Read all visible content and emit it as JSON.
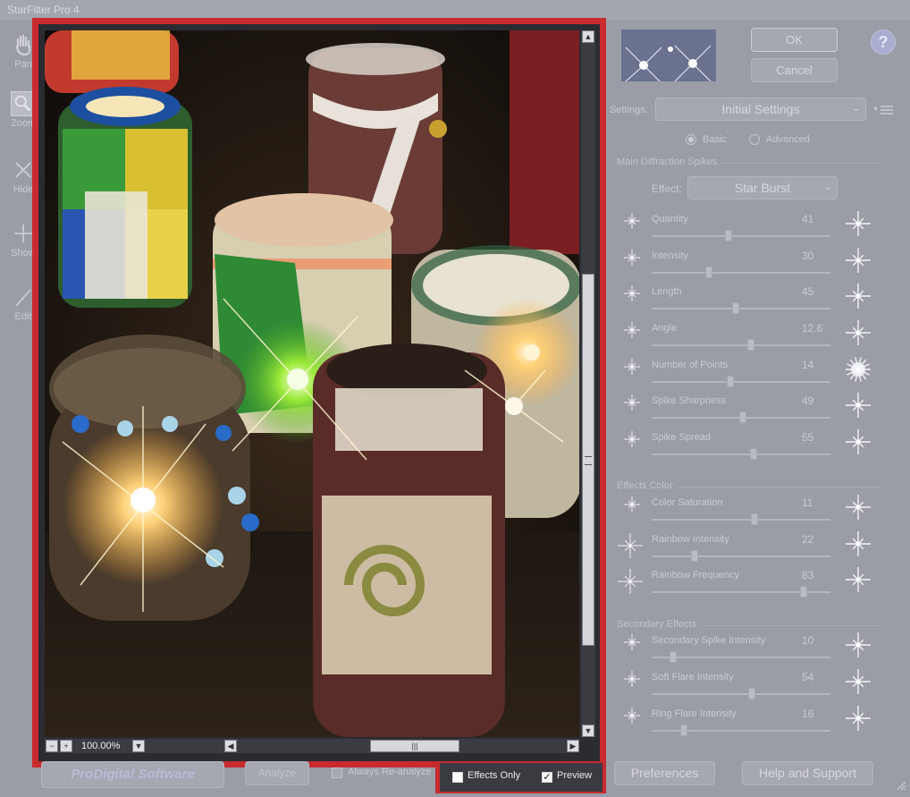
{
  "window": {
    "title": "StarFilter Pro 4"
  },
  "toolbar": {
    "items": [
      {
        "label": "Pan",
        "icon": "hand-icon"
      },
      {
        "label": "Zoom",
        "icon": "magnifier-icon"
      },
      {
        "label": "Hide",
        "icon": "x-icon"
      },
      {
        "label": "Show",
        "icon": "plus-icon"
      },
      {
        "label": "Edit",
        "icon": "pencil-icon"
      }
    ]
  },
  "viewer": {
    "zoom": "100.00%",
    "zoom_out_label": "−",
    "zoom_in_label": "+",
    "effects_only_label": "Effects Only",
    "effects_only_checked": false,
    "preview_label": "Preview",
    "preview_checked": true
  },
  "dialog": {
    "ok_label": "OK",
    "cancel_label": "Cancel",
    "help_label": "?",
    "settings_label": "Settings:",
    "settings_value": "Initial Settings",
    "mode_basic": "Basic",
    "mode_advanced": "Advanced",
    "mode_selected": "Basic"
  },
  "sections": {
    "main": {
      "title": "Main Diffraction Spikes",
      "effect_label": "Effect:",
      "effect_value": "Star Burst",
      "sliders": [
        {
          "label": "Quantity",
          "value": "41"
        },
        {
          "label": "Intensity",
          "value": "30"
        },
        {
          "label": "Length",
          "value": "45"
        },
        {
          "label": "Angle",
          "value": "12.6"
        },
        {
          "label": "Number of Points",
          "value": "14"
        },
        {
          "label": "Spike Sharpness",
          "value": "49"
        },
        {
          "label": "Spike Spread",
          "value": "55"
        }
      ]
    },
    "color": {
      "title": "Effects Color",
      "sliders": [
        {
          "label": "Color Saturation",
          "value": "11"
        },
        {
          "label": "Rainbow Intensity",
          "value": "22"
        },
        {
          "label": "Rainbow Frequency",
          "value": "83"
        }
      ]
    },
    "secondary": {
      "title": "Secondary Effects",
      "sliders": [
        {
          "label": "Secondary Spike Intensity",
          "value": "10"
        },
        {
          "label": "Soft Flare Intensity",
          "value": "54"
        },
        {
          "label": "Ring Flare Intensity",
          "value": "16"
        }
      ]
    }
  },
  "footer": {
    "brand": "ProDigital Software",
    "analyze_label": "Analyze",
    "always_reanalyze_label": "Always Re-analyze",
    "preferences_label": "Preferences",
    "help_support_label": "Help and Support"
  },
  "colors": {
    "frame": "#c82a2e",
    "panel": "#9a9da6"
  }
}
